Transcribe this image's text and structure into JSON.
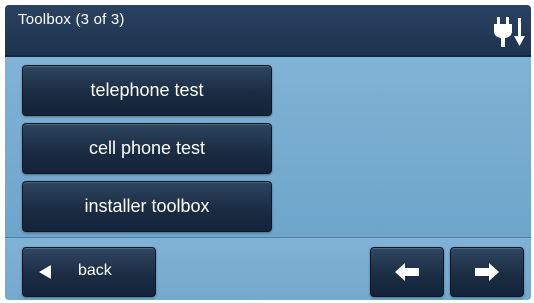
{
  "header": {
    "title": "Toolbox (3 of 3)",
    "status_icon": "plug-power-icon"
  },
  "menu": {
    "items": [
      {
        "label": "telephone test"
      },
      {
        "label": "cell phone test"
      },
      {
        "label": "installer toolbox"
      }
    ]
  },
  "footer": {
    "back_label": "back",
    "prev_icon": "arrow-left-icon",
    "next_icon": "arrow-right-icon"
  },
  "colors": {
    "titlebar": "#1d3350",
    "background": "#74a9cd",
    "button": "#1a2c42",
    "text": "#ffffff"
  }
}
